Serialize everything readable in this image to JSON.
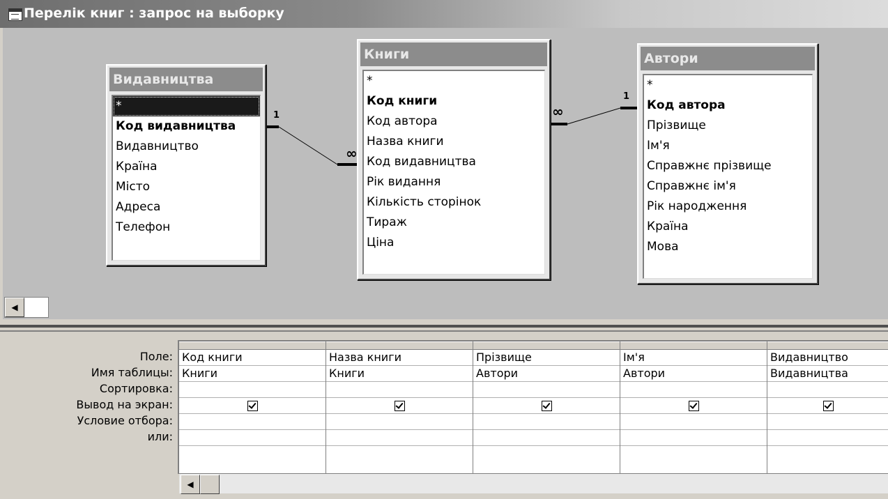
{
  "window": {
    "title": "Перелік книг : запрос на выборку"
  },
  "diagram": {
    "tables": [
      {
        "title": "Видавництва",
        "fields": [
          "*",
          "Код видавництва",
          "Видавництво",
          "Країна",
          "Місто",
          "Адреса",
          "Телефон"
        ]
      },
      {
        "title": "Книги",
        "fields": [
          "*",
          "Код книги",
          "Код автора",
          "Назва книги",
          "Код видавництва",
          "Рік видання",
          "Кількість сторінок",
          "Тираж",
          "Ціна"
        ]
      },
      {
        "title": "Автори",
        "fields": [
          "*",
          "Код автора",
          "Прізвище",
          "Ім'я",
          "Справжнє прізвище",
          "Справжнє ім'я",
          "Рік народження",
          "Країна",
          "Мова"
        ]
      }
    ],
    "relations": [
      {
        "one": "1",
        "many": "∞"
      },
      {
        "one": "1",
        "many": "∞"
      }
    ]
  },
  "grid": {
    "row_labels": [
      "Поле:",
      "Имя таблицы:",
      "Сортировка:",
      "Вывод на экран:",
      "Условие отбора:",
      "или:"
    ],
    "columns": [
      {
        "field": "Код книги",
        "table": "Книги",
        "sort": "",
        "show": true,
        "criteria": "",
        "or": ""
      },
      {
        "field": "Назва книги",
        "table": "Книги",
        "sort": "",
        "show": true,
        "criteria": "",
        "or": ""
      },
      {
        "field": "Прізвище",
        "table": "Автори",
        "sort": "",
        "show": true,
        "criteria": "",
        "or": ""
      },
      {
        "field": "Ім'я",
        "table": "Автори",
        "sort": "",
        "show": true,
        "criteria": "",
        "or": ""
      },
      {
        "field": "Видавництво",
        "table": "Видавництва",
        "sort": "",
        "show": true,
        "criteria": "",
        "or": ""
      }
    ]
  },
  "icons": {
    "window": "query-window-icon",
    "scroll_left": "scroll-left-arrow-icon",
    "checkbox": "checkbox-checked-icon"
  },
  "colors": {
    "titlebar_start": "#6e6e6e",
    "titlebar_end": "#dcdcdc",
    "table_header": "#8c8c8c",
    "selected_row": "#1a1a1a"
  }
}
